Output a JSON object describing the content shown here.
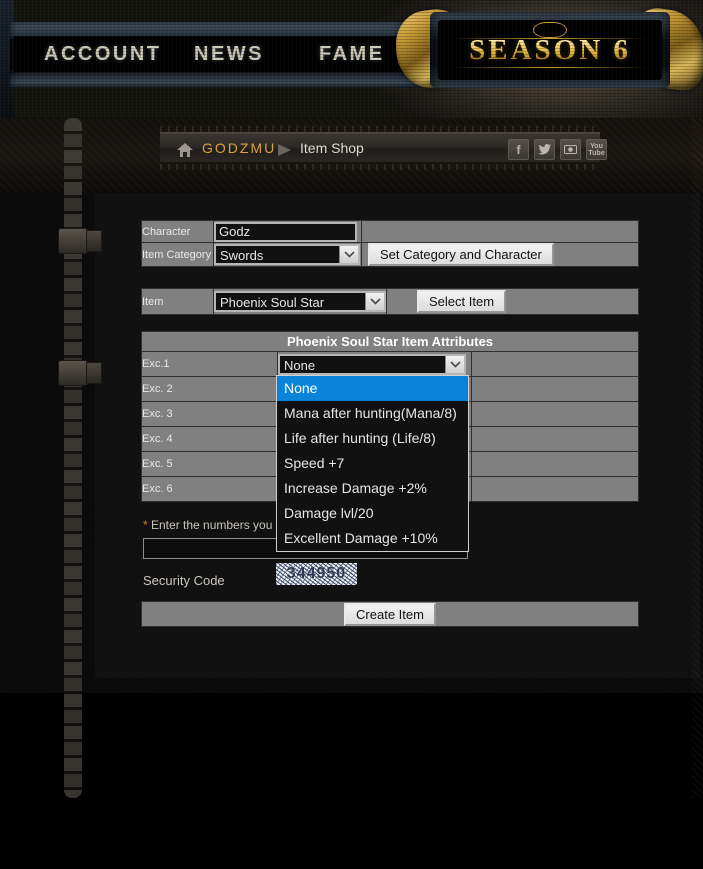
{
  "banner": {
    "nav": [
      {
        "label": "ACCOUNT",
        "name": "nav-account"
      },
      {
        "label": "NEWS",
        "name": "nav-news"
      },
      {
        "label": "FAME",
        "name": "nav-fame"
      }
    ],
    "season_title": "SEASON 6"
  },
  "breadcrumb": {
    "home_icon": "home-icon",
    "user": "GODZMU",
    "arrow_icon": "chevron-right-icon",
    "page": "Item Shop",
    "social": [
      {
        "glyph": "f",
        "name": "facebook-icon"
      },
      {
        "glyph": "ᴠ",
        "name": "twitter-icon"
      },
      {
        "glyph": "▣",
        "name": "instagram-icon"
      },
      {
        "glyph": "You",
        "glyph2": "Tube",
        "name": "youtube-icon"
      }
    ]
  },
  "form": {
    "character": {
      "label": "Character",
      "value": "Godz",
      "placeholder": ""
    },
    "item_category": {
      "label": "Item Category",
      "value": "Swords",
      "button": "Set Category and Character"
    },
    "item": {
      "label": "Item",
      "value": "Phoenix Soul Star",
      "button": "Select Item"
    },
    "attributes": {
      "header": "Phoenix Soul Star Item Attributes",
      "rows": [
        {
          "label": "Exc.1",
          "value": "None"
        },
        {
          "label": "Exc. 2",
          "value": ""
        },
        {
          "label": "Exc. 3",
          "value": ""
        },
        {
          "label": "Exc. 4",
          "value": ""
        },
        {
          "label": "Exc. 5",
          "value": ""
        },
        {
          "label": "Exc. 6",
          "value": ""
        }
      ]
    },
    "dropdown": {
      "open": true,
      "selected": "None",
      "options": [
        "None",
        "Mana after hunting(Mana/8)",
        "Life after hunting (Life/8)",
        "Speed +7",
        "Increase Damage +2%",
        "Damage lvl/20",
        "Excellent Damage +10%"
      ]
    },
    "captcha_note_star": "*",
    "captcha_note": " Enter the numbers you see in the image below",
    "captcha_input_value": "",
    "captcha_input_placeholder": "",
    "security_label": "Security Code",
    "captcha_code": "344950",
    "submit_label": "Create Item"
  },
  "colors": {
    "accent_gold": "#d9a33a",
    "highlight_blue": "#0a84d8",
    "panel_gray": "#808080",
    "page_bg": "#0a0a0a"
  }
}
